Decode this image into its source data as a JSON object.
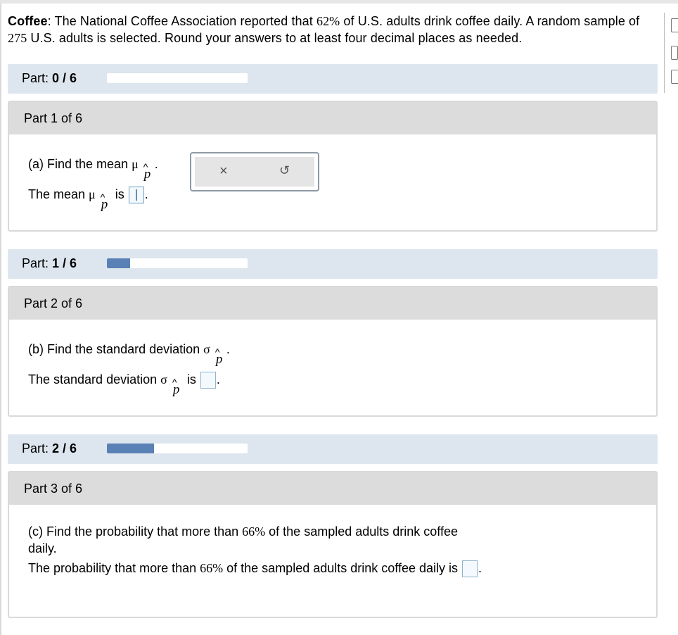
{
  "problem": {
    "bold_label": "Coffee",
    "text_before": ": The National Coffee Association reported that ",
    "percent": "62%",
    "text_middle": " of U.S. adults drink coffee daily. A random sample of ",
    "sample_size": "275",
    "text_after": " U.S. adults is selected. Round your answers to at least four decimal places as needed."
  },
  "progress": [
    {
      "label": "Part:",
      "value": "0 / 6",
      "fraction": 0.0
    },
    {
      "label": "Part:",
      "value": "1 / 6",
      "fraction": 0.1667
    },
    {
      "label": "Part:",
      "value": "2 / 6",
      "fraction": 0.3333
    }
  ],
  "parts": [
    {
      "header": "Part 1 of 6",
      "question": "(a) Find the mean ",
      "symbol": "μ",
      "sub": "p",
      "answer_prefix": "The mean ",
      "answer_suffix": " is ",
      "period": "."
    },
    {
      "header": "Part 2 of 6",
      "question": "(b) Find the standard deviation ",
      "symbol": "σ",
      "sub": "p",
      "answer_prefix": "The standard deviation ",
      "answer_suffix": " is ",
      "period": "."
    },
    {
      "header": "Part 3 of 6",
      "question_a": "(c) Find the probability that more than ",
      "percent": "66%",
      "question_b": " of the sampled adults drink coffee daily.",
      "answer_a": "The probability that more than ",
      "answer_b": " of the sampled adults drink coffee daily is ",
      "period": "."
    }
  ],
  "tools": {
    "clear": "×",
    "undo": "↺"
  },
  "hat": "^"
}
